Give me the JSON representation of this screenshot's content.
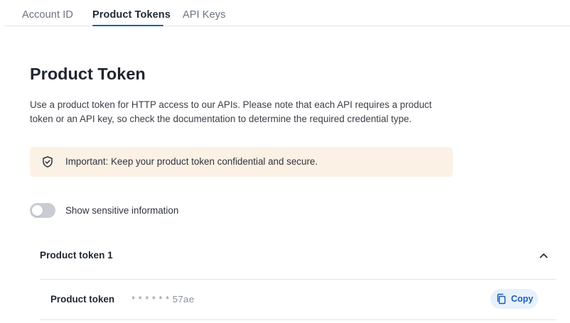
{
  "tabs": [
    {
      "label": "Account ID",
      "active": false
    },
    {
      "label": "Product Tokens",
      "active": true
    },
    {
      "label": "API Keys",
      "active": false
    }
  ],
  "page": {
    "title": "Product Token",
    "description": "Use a product token for HTTP access to our APIs. Please note that each API requires a product token or an API key, so check the documentation to determine the required credential type."
  },
  "alert": {
    "icon": "shield-check-icon",
    "text": "Important: Keep your product token confidential and secure.",
    "background": "#fbf1e4"
  },
  "sensitive_toggle": {
    "label": "Show sensitive information",
    "checked": false
  },
  "token_section": {
    "header": "Product token 1",
    "expanded": true,
    "row_label": "Product token",
    "masked_value": "* * * * * * 57ae",
    "copy_label": "Copy"
  },
  "colors": {
    "accent": "#1a5fb4",
    "copy_button_bg": "#e8f1fb",
    "toggle_off": "#c9cdd3"
  }
}
